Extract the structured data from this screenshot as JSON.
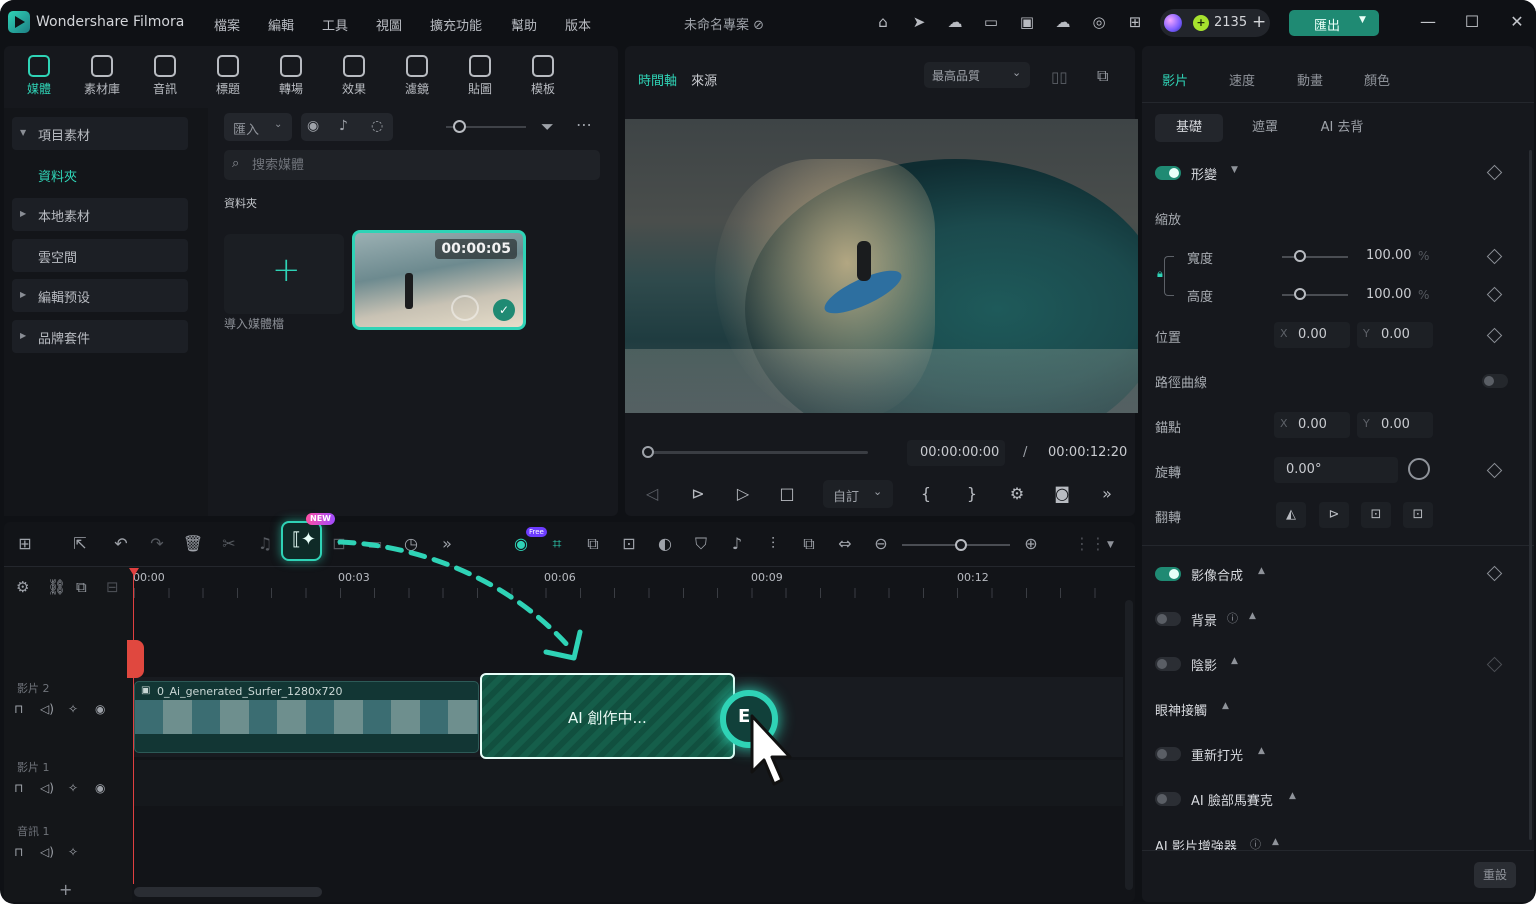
{
  "app": {
    "name": "Wondershare Filmora",
    "project_title": "未命名專案"
  },
  "menu": [
    "檔案",
    "編輯",
    "工具",
    "視圖",
    "擴充功能",
    "幫助",
    "版本"
  ],
  "header": {
    "credits": "2135",
    "export_label": "匯出"
  },
  "library_tabs": [
    "媒體",
    "素材庫",
    "音訊",
    "標題",
    "轉場",
    "效果",
    "濾鏡",
    "貼圖",
    "模板"
  ],
  "sidebar": {
    "items": [
      {
        "label": "項目素材",
        "expanded": true
      },
      {
        "label": "資料夾",
        "sub": true
      },
      {
        "label": "本地素材"
      },
      {
        "label": "雲空間"
      },
      {
        "label": "編輯预设"
      },
      {
        "label": "品牌套件"
      }
    ]
  },
  "media": {
    "import_label": "匯入",
    "search_placeholder": "搜索媒體",
    "folder_label": "資料夾",
    "import_tile_label": "導入媒體檔",
    "thumb_duration": "00:00:05"
  },
  "preview": {
    "tab_timeline": "時間軸",
    "tab_source": "來源",
    "quality": "最高品質",
    "current_time": "00:00:00:00",
    "separator": "/",
    "total_time": "00:00:12:20",
    "ratio": "自訂"
  },
  "properties": {
    "tabs": [
      "影片",
      "速度",
      "動畫",
      "顏色"
    ],
    "subtabs": [
      "基礎",
      "遮罩",
      "AI 去背"
    ],
    "transform": "形變",
    "scale": "縮放",
    "width_label": "寬度",
    "width_value": "100.00",
    "height_label": "高度",
    "height_value": "100.00",
    "percent": "%",
    "position": "位置",
    "pos_x": "0.00",
    "pos_y": "0.00",
    "path_curve": "路徑曲線",
    "anchor": "錨點",
    "anchor_x": "0.00",
    "anchor_y": "0.00",
    "rotate": "旋轉",
    "rotate_value": "0.00°",
    "flip": "翻轉",
    "compositing": "影像合成",
    "background": "背景",
    "shadow": "陰影",
    "eye_contact": "眼神接觸",
    "relight": "重新打光",
    "face_mosaic": "AI 臉部馬賽克",
    "enhancer": "AI 影片增強器",
    "reset": "重設",
    "axis_x": "X",
    "axis_y": "Y"
  },
  "timeline": {
    "ruler": [
      "00:00",
      "00:03",
      "00:06",
      "00:09",
      "00:12"
    ],
    "tracks": [
      "影片 2",
      "影片 1",
      "音訊 1"
    ],
    "clip_name": "0_Ai_generated_Surfer_1280x720",
    "ai_clip_label": "AI 創作中...",
    "new_badge": "NEW",
    "free_badge": "Free"
  },
  "colors": {
    "accent": "#2fd3b6",
    "export": "#1f8a73",
    "playhead": "#e04040"
  }
}
